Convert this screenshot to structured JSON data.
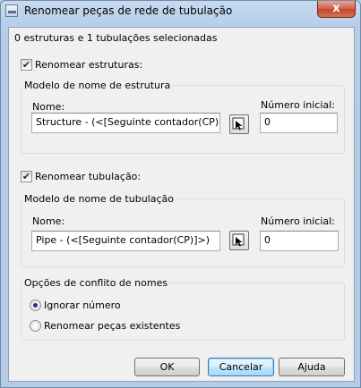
{
  "window": {
    "title": "Renomear peças de rede de tubulação",
    "close_glyph": "x"
  },
  "selection_summary": "0 estruturas e 1 tubulações selecionadas",
  "structures": {
    "checkbox_label": "Renomear estruturas:",
    "checked": true,
    "group_title": "Modelo de nome de estrutura",
    "name_label": "Nome:",
    "name_value": "Structure - (<[Seguinte contador(CP)]>)",
    "start_label": "Número inicial:",
    "start_value": "0"
  },
  "pipes": {
    "checkbox_label": "Renomear tubulação:",
    "checked": true,
    "group_title": "Modelo de nome de tubulação",
    "name_label": "Nome:",
    "name_value": "Pipe - (<[Seguinte contador(CP)]>)",
    "start_label": "Número inicial:",
    "start_value": "0"
  },
  "conflict": {
    "group_title": "Opções de conflito de nomes",
    "options": [
      {
        "label": "Ignorar número",
        "selected": true
      },
      {
        "label": "Renomear peças existentes",
        "selected": false
      }
    ]
  },
  "buttons": {
    "ok": "OK",
    "cancel": "Cancelar",
    "help": "Ajuda"
  }
}
